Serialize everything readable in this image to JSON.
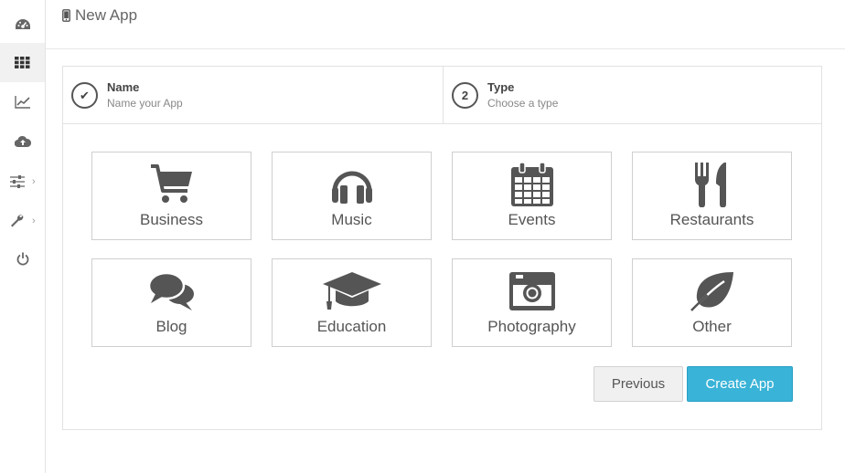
{
  "header": {
    "title": "New App",
    "title_icon": "mobile-phone-icon"
  },
  "sidebar": {
    "items": [
      {
        "icon": "dashboard-icon",
        "active": false,
        "has_submenu": false
      },
      {
        "icon": "apps-grid-icon",
        "active": true,
        "has_submenu": false
      },
      {
        "icon": "analytics-chart-icon",
        "active": false,
        "has_submenu": false
      },
      {
        "icon": "cloud-upload-icon",
        "active": false,
        "has_submenu": false
      },
      {
        "icon": "sliders-icon",
        "active": false,
        "has_submenu": true
      },
      {
        "icon": "wrench-icon",
        "active": false,
        "has_submenu": true
      },
      {
        "icon": "power-icon",
        "active": false,
        "has_submenu": false
      }
    ],
    "chevron": "›"
  },
  "wizard": {
    "steps": [
      {
        "marker": "✔",
        "title": "Name",
        "subtitle": "Name your App",
        "completed": true
      },
      {
        "marker": "2",
        "title": "Type",
        "subtitle": "Choose a type",
        "completed": false
      }
    ],
    "types": [
      {
        "label": "Business",
        "icon": "shopping-cart-icon"
      },
      {
        "label": "Music",
        "icon": "headphones-icon"
      },
      {
        "label": "Events",
        "icon": "calendar-icon"
      },
      {
        "label": "Restaurants",
        "icon": "fork-knife-icon"
      },
      {
        "label": "Blog",
        "icon": "chat-bubbles-icon"
      },
      {
        "label": "Education",
        "icon": "graduation-cap-icon"
      },
      {
        "label": "Photography",
        "icon": "camera-icon"
      },
      {
        "label": "Other",
        "icon": "leaf-icon"
      }
    ],
    "buttons": {
      "previous": "Previous",
      "create": "Create App"
    }
  },
  "colors": {
    "accent": "#39b3d7",
    "icon": "#555555",
    "border": "#cfcfcf"
  }
}
